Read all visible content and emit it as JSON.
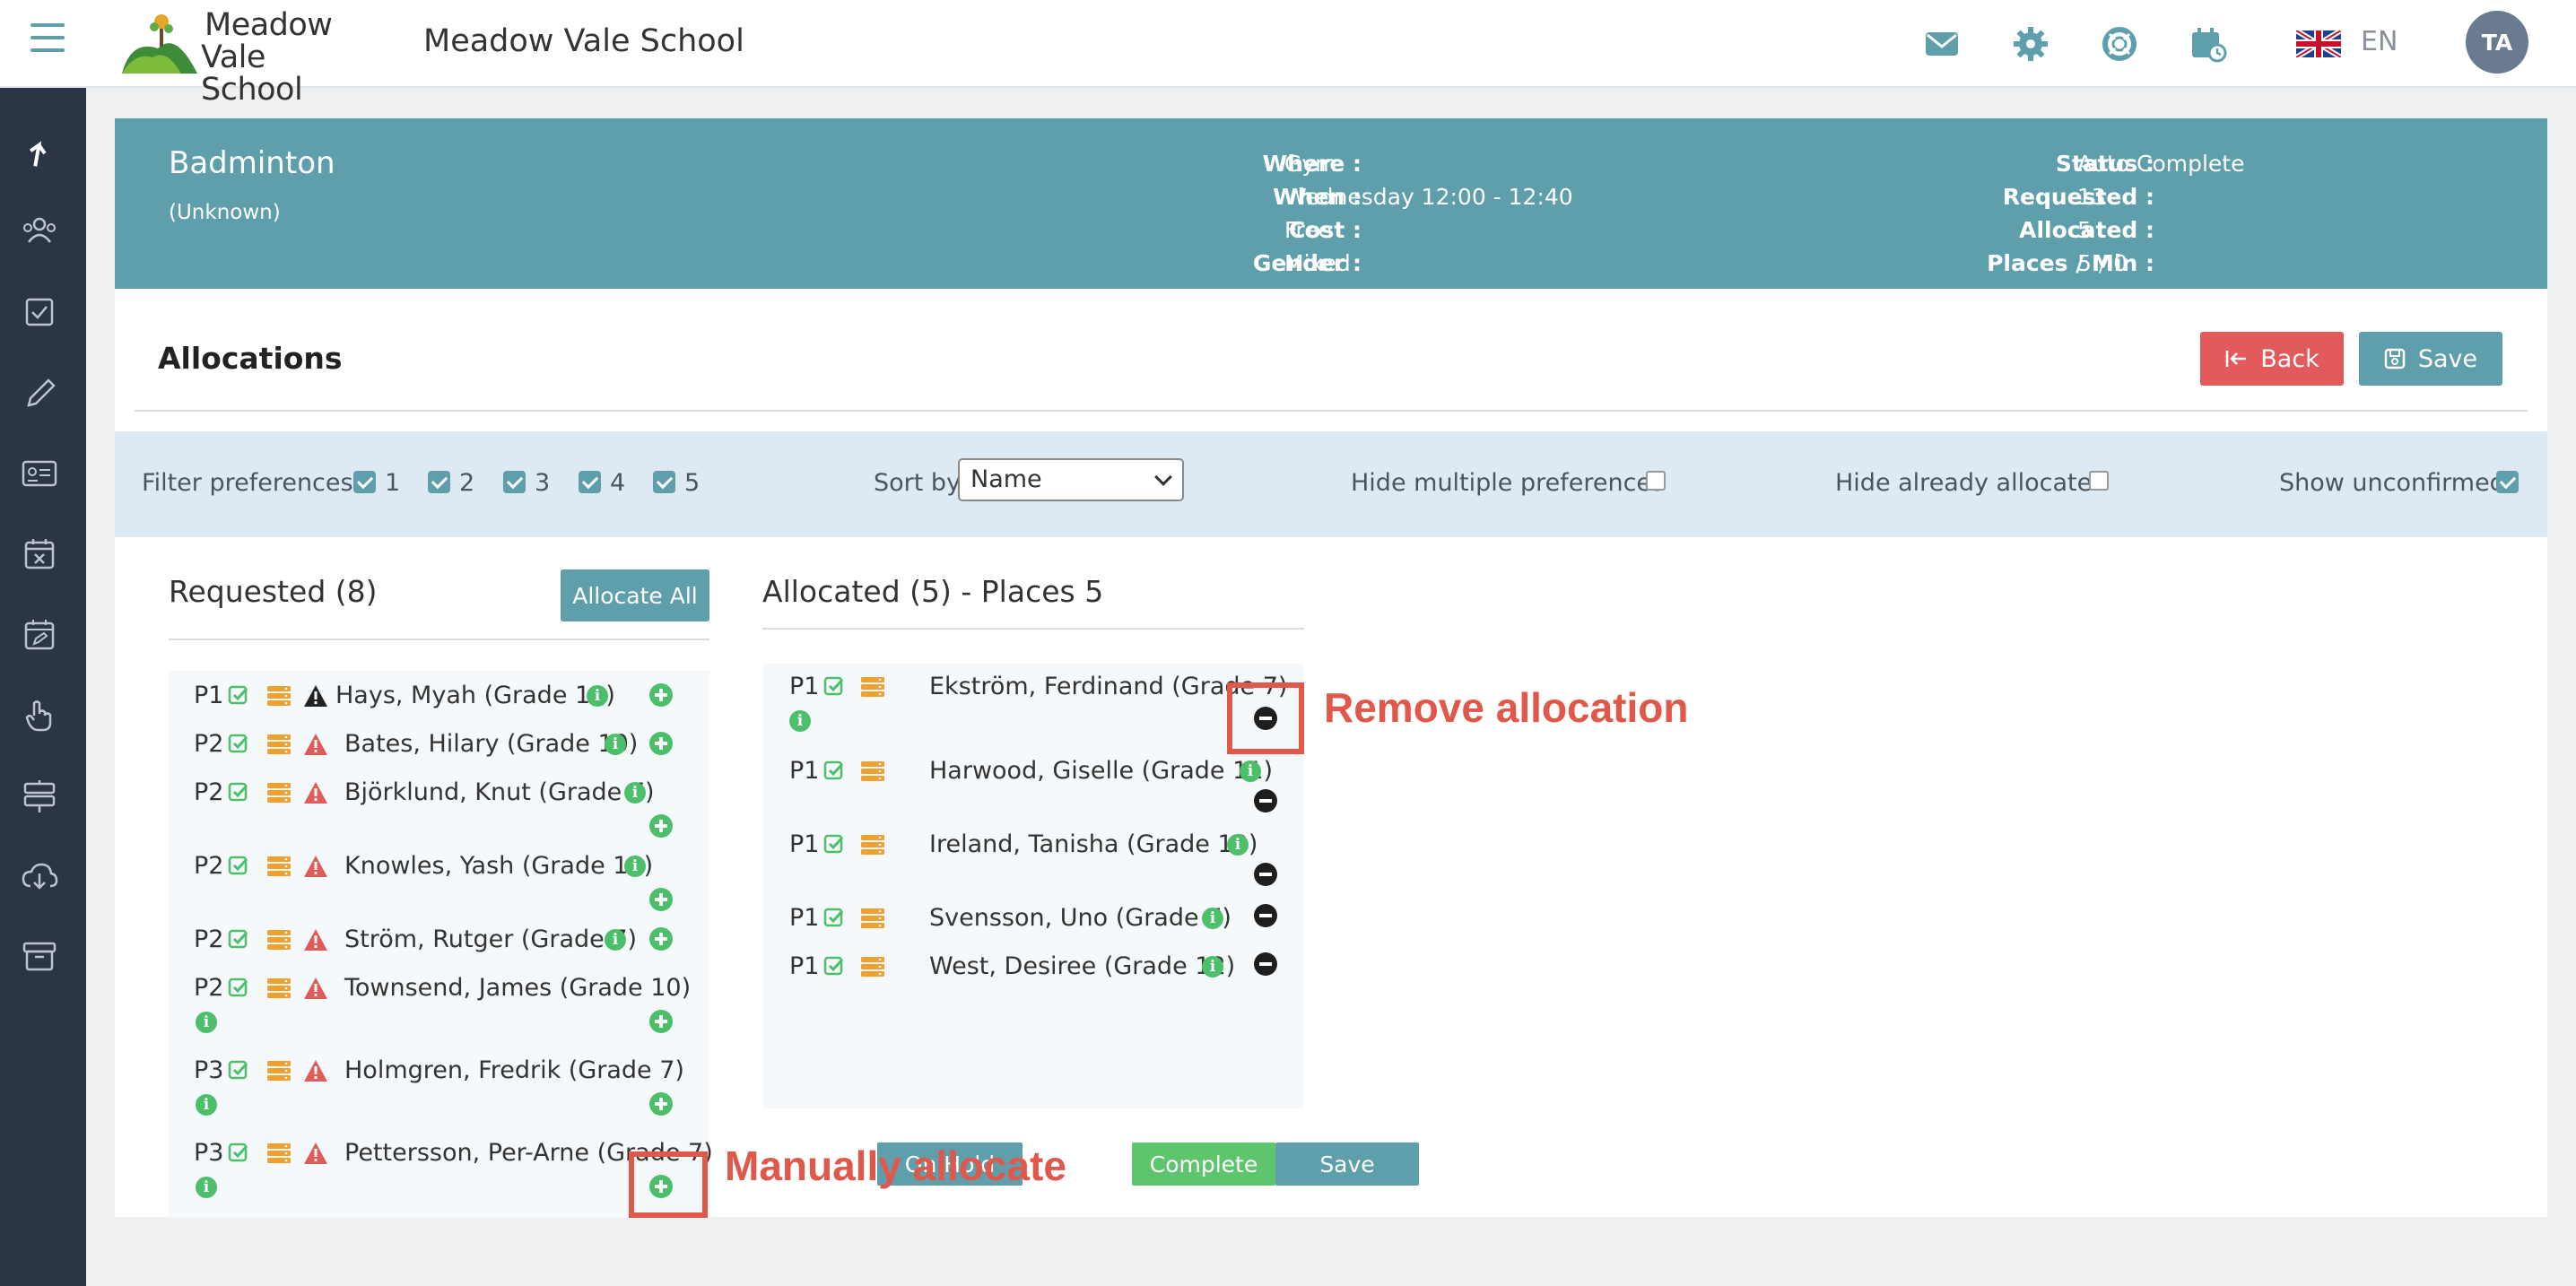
{
  "header": {
    "logo_line1": "Meadow",
    "logo_line2": "Vale School",
    "school_name": "Meadow Vale School",
    "language": "EN",
    "avatar_initials": "TA"
  },
  "activity": {
    "title": "Badminton",
    "subtitle": "(Unknown)",
    "where_label": "Where :",
    "where": "Gym",
    "when_label": "When :",
    "when": "Wednesday 12:00 - 12:40",
    "cost_label": "Cost :",
    "cost": "Free",
    "gender_label": "Gender :",
    "gender": "Mixed",
    "status_label": "Status :",
    "status": "Auto Complete",
    "requested_label": "Requested :",
    "requested": "13",
    "allocated_label": "Allocated :",
    "allocated": "5",
    "places_label": "Places / Min :",
    "places": "5 / 0"
  },
  "allocations": {
    "title": "Allocations",
    "back_label": "Back",
    "save_label": "Save"
  },
  "filters": {
    "filter_label": "Filter preferences",
    "prefs": [
      "1",
      "2",
      "3",
      "4",
      "5"
    ],
    "sort_label": "Sort by",
    "sort_value": "Name",
    "hide_multiple_label": "Hide multiple preferences",
    "hide_allocated_label": "Hide already allocated",
    "show_unconfirmed_label": "Show unconfirmed"
  },
  "requested": {
    "title": "Requested (8)",
    "allocate_all_label": "Allocate All",
    "rows": [
      {
        "pref": "P1",
        "name": "Hays, Myah (Grade 11)"
      },
      {
        "pref": "P2",
        "name": "Bates, Hilary (Grade 10)"
      },
      {
        "pref": "P2",
        "name": "Björklund, Knut (Grade 7)"
      },
      {
        "pref": "P2",
        "name": "Knowles, Yash (Grade 10)"
      },
      {
        "pref": "P2",
        "name": "Ström, Rutger (Grade 7)"
      },
      {
        "pref": "P2",
        "name": "Townsend, James (Grade 10)"
      },
      {
        "pref": "P3",
        "name": "Holmgren, Fredrik (Grade 7)"
      },
      {
        "pref": "P3",
        "name": "Pettersson, Per-Arne (Grade 7)"
      }
    ]
  },
  "allocated": {
    "title": "Allocated (5) - Places 5",
    "rows": [
      {
        "pref": "P1",
        "name": "Ekström, Ferdinand (Grade 7)"
      },
      {
        "pref": "P1",
        "name": "Harwood, Giselle (Grade 11)"
      },
      {
        "pref": "P1",
        "name": "Ireland, Tanisha (Grade 12)"
      },
      {
        "pref": "P1",
        "name": "Svensson, Uno (Grade 7)"
      },
      {
        "pref": "P1",
        "name": "West, Desiree (Grade 12)"
      }
    ],
    "on_hold_label": "On Hold",
    "complete_label": "Complete",
    "save_label": "Save"
  },
  "annotations": {
    "remove": "Remove allocation",
    "manual": "Manually allocate"
  },
  "colors": {
    "teal": "#5f9fab",
    "red": "#e35a5a",
    "green": "#4cbf6b",
    "sidebar": "#2c3545",
    "annotation": "#e0584a"
  }
}
